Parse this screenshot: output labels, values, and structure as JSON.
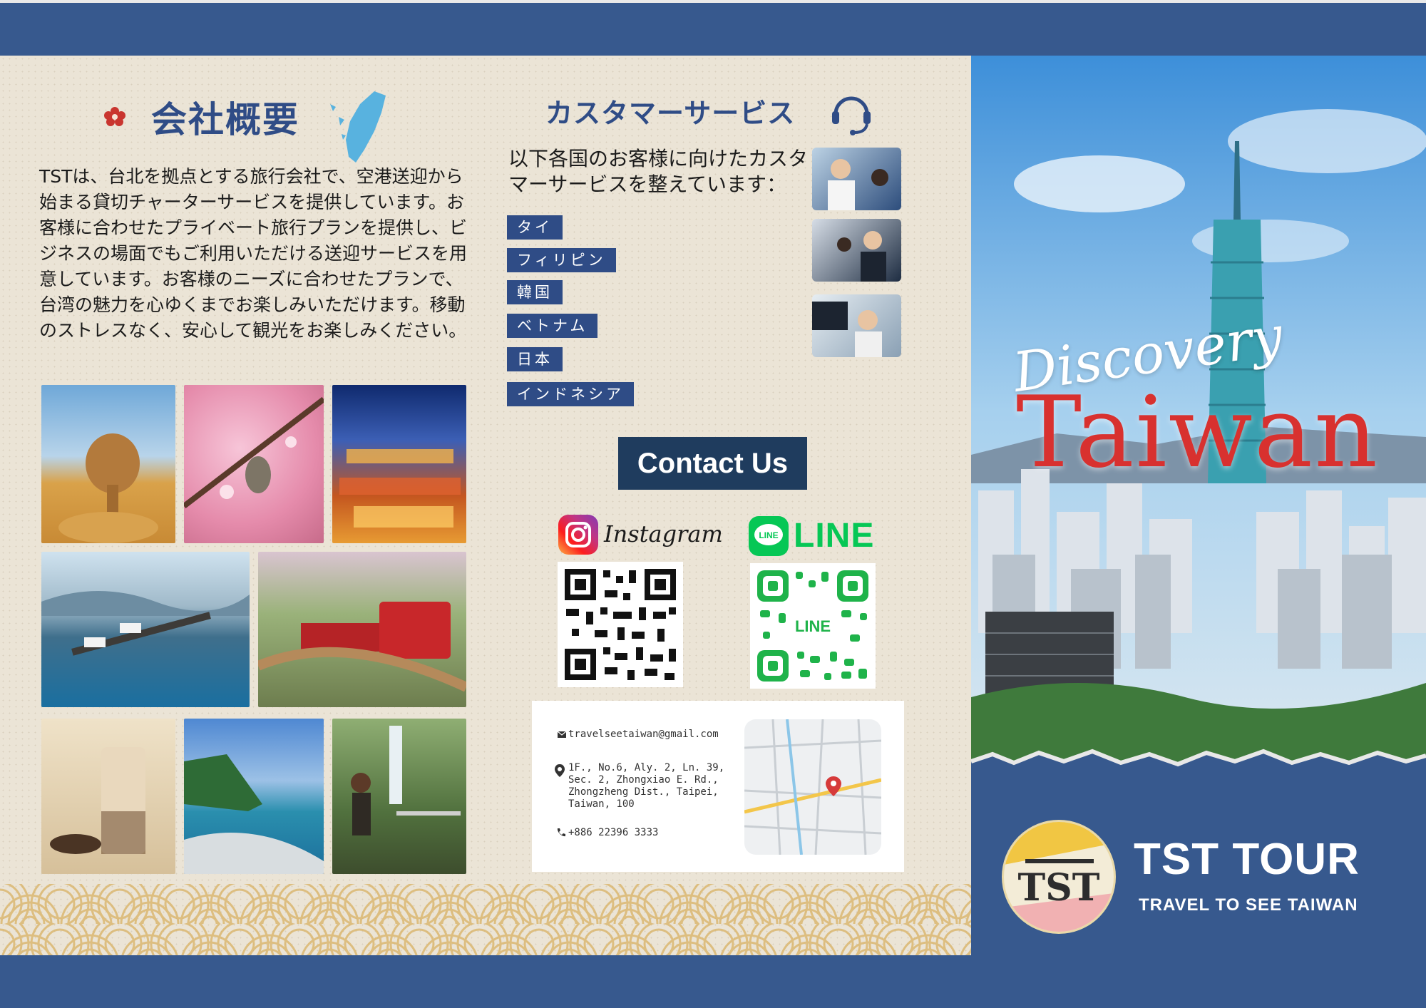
{
  "company": {
    "section_title": "会社概要",
    "intro": "TSTは、台北を拠点とする旅行会社で、空港送迎から始まる貸切チャーターサービスを提供しています。お客様に合わせたプライベート旅行プランを提供し、ビジネスの場面でもご利用いただける送迎サービスを用意しています。お客様のニーズに合わせたプランで、台湾の魅力を心ゆくまでお楽しみいただけます。移動のストレスなく、安心して観光をお楽しみください。"
  },
  "customer_service": {
    "title": "カスタマーサービス",
    "text": "以下各国のお客様に向けたカスタマーサービスを整えています：",
    "languages": [
      "タイ",
      "フィリピン",
      "韓国",
      "ベトナム",
      "日本",
      "インドネシア"
    ]
  },
  "contact": {
    "button_label": "Contact Us",
    "instagram_label": "Instagram",
    "line_label": "LINE",
    "email": "travelseetaiwan@gmail.com",
    "address": "1F., No.6, Aly. 2, Ln. 39,\nSec. 2, Zhongxiao E. Rd.,\nZhongzheng Dist., Taipei,\nTaiwan, 100",
    "phone": "+886 22396 3333"
  },
  "cover": {
    "discovery": "Discovery",
    "taiwan": "Taiwan",
    "brand_name": "TST TOUR",
    "brand_sub": "TRAVEL TO SEE TAIWAN"
  },
  "colors": {
    "band": "#37598e",
    "title_blue": "#2f4c86",
    "accent_red": "#d8312f",
    "line_green": "#06c755",
    "button_navy": "#1f3c5e"
  }
}
